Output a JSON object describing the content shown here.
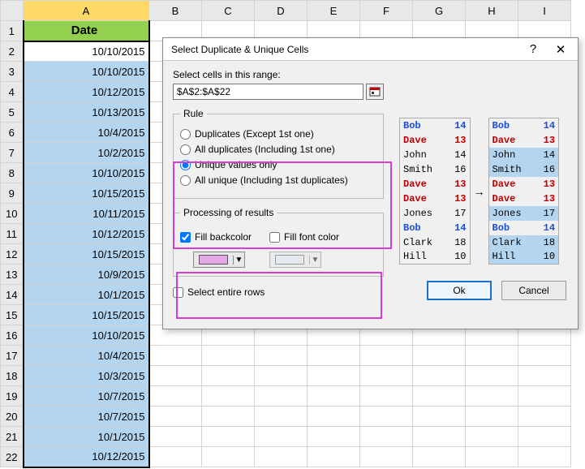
{
  "columns": [
    "A",
    "B",
    "C",
    "D",
    "E",
    "F",
    "G",
    "H",
    "I"
  ],
  "rows": [
    1,
    2,
    3,
    4,
    5,
    6,
    7,
    8,
    9,
    10,
    11,
    12,
    13,
    14,
    15,
    16,
    17,
    18,
    19,
    20,
    21,
    22
  ],
  "headerLabel": "Date",
  "activeRow": 2,
  "dates": [
    "10/10/2015",
    "10/10/2015",
    "10/12/2015",
    "10/13/2015",
    "10/4/2015",
    "10/2/2015",
    "10/10/2015",
    "10/15/2015",
    "10/11/2015",
    "10/12/2015",
    "10/15/2015",
    "10/9/2015",
    "10/1/2015",
    "10/15/2015",
    "10/10/2015",
    "10/4/2015",
    "10/3/2015",
    "10/7/2015",
    "10/7/2015",
    "10/1/2015",
    "10/12/2015"
  ],
  "dialog": {
    "title": "Select Duplicate & Unique Cells",
    "help": "?",
    "close": "✕",
    "rangeLabel": "Select cells in this range:",
    "rangeValue": "$A$2:$A$22",
    "ruleLegend": "Rule",
    "ruleOptions": [
      "Duplicates (Except 1st one)",
      "All duplicates (Including 1st one)",
      "Unique values only",
      "All unique (Including 1st duplicates)"
    ],
    "ruleSelected": 2,
    "procLegend": "Processing of results",
    "fillBackcolor": "Fill backcolor",
    "fillBackcolorChecked": true,
    "fillBackSwatch": "#e6a8e6",
    "fillFontcolor": "Fill font color",
    "fillFontcolorChecked": false,
    "fillFontSwatch": "#dce6ef",
    "selectEntireRows": "Select entire rows",
    "selectEntireChecked": false,
    "ok": "Ok",
    "cancel": "Cancel"
  },
  "preview": {
    "left": [
      {
        "name": "Bob",
        "v": "14",
        "c": "blue"
      },
      {
        "name": "Dave",
        "v": "13",
        "c": "red"
      },
      {
        "name": "John",
        "v": "14",
        "c": ""
      },
      {
        "name": "Smith",
        "v": "16",
        "c": ""
      },
      {
        "name": "Dave",
        "v": "13",
        "c": "red"
      },
      {
        "name": "Dave",
        "v": "13",
        "c": "red"
      },
      {
        "name": "Jones",
        "v": "17",
        "c": ""
      },
      {
        "name": "Bob",
        "v": "14",
        "c": "blue"
      },
      {
        "name": "Clark",
        "v": "18",
        "c": ""
      },
      {
        "name": "Hill",
        "v": "10",
        "c": ""
      }
    ],
    "right": [
      {
        "name": "Bob",
        "v": "14",
        "c": "blue",
        "hl": false
      },
      {
        "name": "Dave",
        "v": "13",
        "c": "red",
        "hl": false
      },
      {
        "name": "John",
        "v": "14",
        "c": "",
        "hl": true
      },
      {
        "name": "Smith",
        "v": "16",
        "c": "",
        "hl": true
      },
      {
        "name": "Dave",
        "v": "13",
        "c": "red",
        "hl": false
      },
      {
        "name": "Dave",
        "v": "13",
        "c": "red",
        "hl": false
      },
      {
        "name": "Jones",
        "v": "17",
        "c": "",
        "hl": true
      },
      {
        "name": "Bob",
        "v": "14",
        "c": "blue",
        "hl": false
      },
      {
        "name": "Clark",
        "v": "18",
        "c": "",
        "hl": true
      },
      {
        "name": "Hill",
        "v": "10",
        "c": "",
        "hl": true
      }
    ],
    "arrow": "→"
  }
}
